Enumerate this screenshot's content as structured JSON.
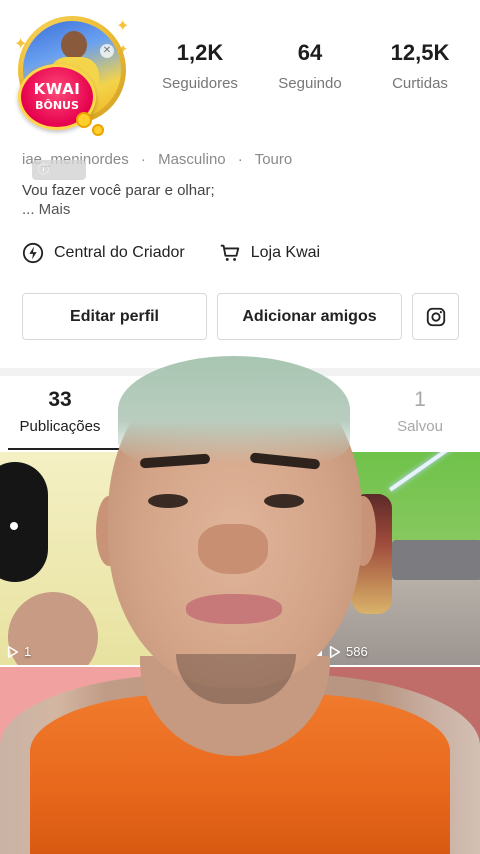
{
  "profile": {
    "badge_line1": "KWAI",
    "badge_line2": "BÔNUS",
    "username": "iae_meninordes",
    "gender": "Masculino",
    "sign": "Touro",
    "bio_text": "Vou fazer você parar e olhar;",
    "bio_more": "...  Mais"
  },
  "stats": [
    {
      "value": "1,2K",
      "label": "Seguidores"
    },
    {
      "value": "64",
      "label": "Seguindo"
    },
    {
      "value": "12,5K",
      "label": "Curtidas"
    }
  ],
  "links": {
    "creator_center": "Central do Criador",
    "shop": "Loja Kwai"
  },
  "buttons": {
    "edit_profile": "Editar perfil",
    "add_friends": "Adicionar amigos"
  },
  "tabs": {
    "posts": {
      "count": "33",
      "label": "Publicações"
    },
    "saved": {
      "count": "1",
      "label": "Salvou"
    }
  },
  "grid": {
    "item1_views": "1",
    "item3_views": "586"
  },
  "icons": [
    "close-icon",
    "lightning-icon",
    "cart-icon",
    "instagram-icon",
    "play-icon"
  ],
  "colors": {
    "badge": "#e6004e",
    "shirt": "#e8681c",
    "ring_gold": "#f0c23c"
  }
}
